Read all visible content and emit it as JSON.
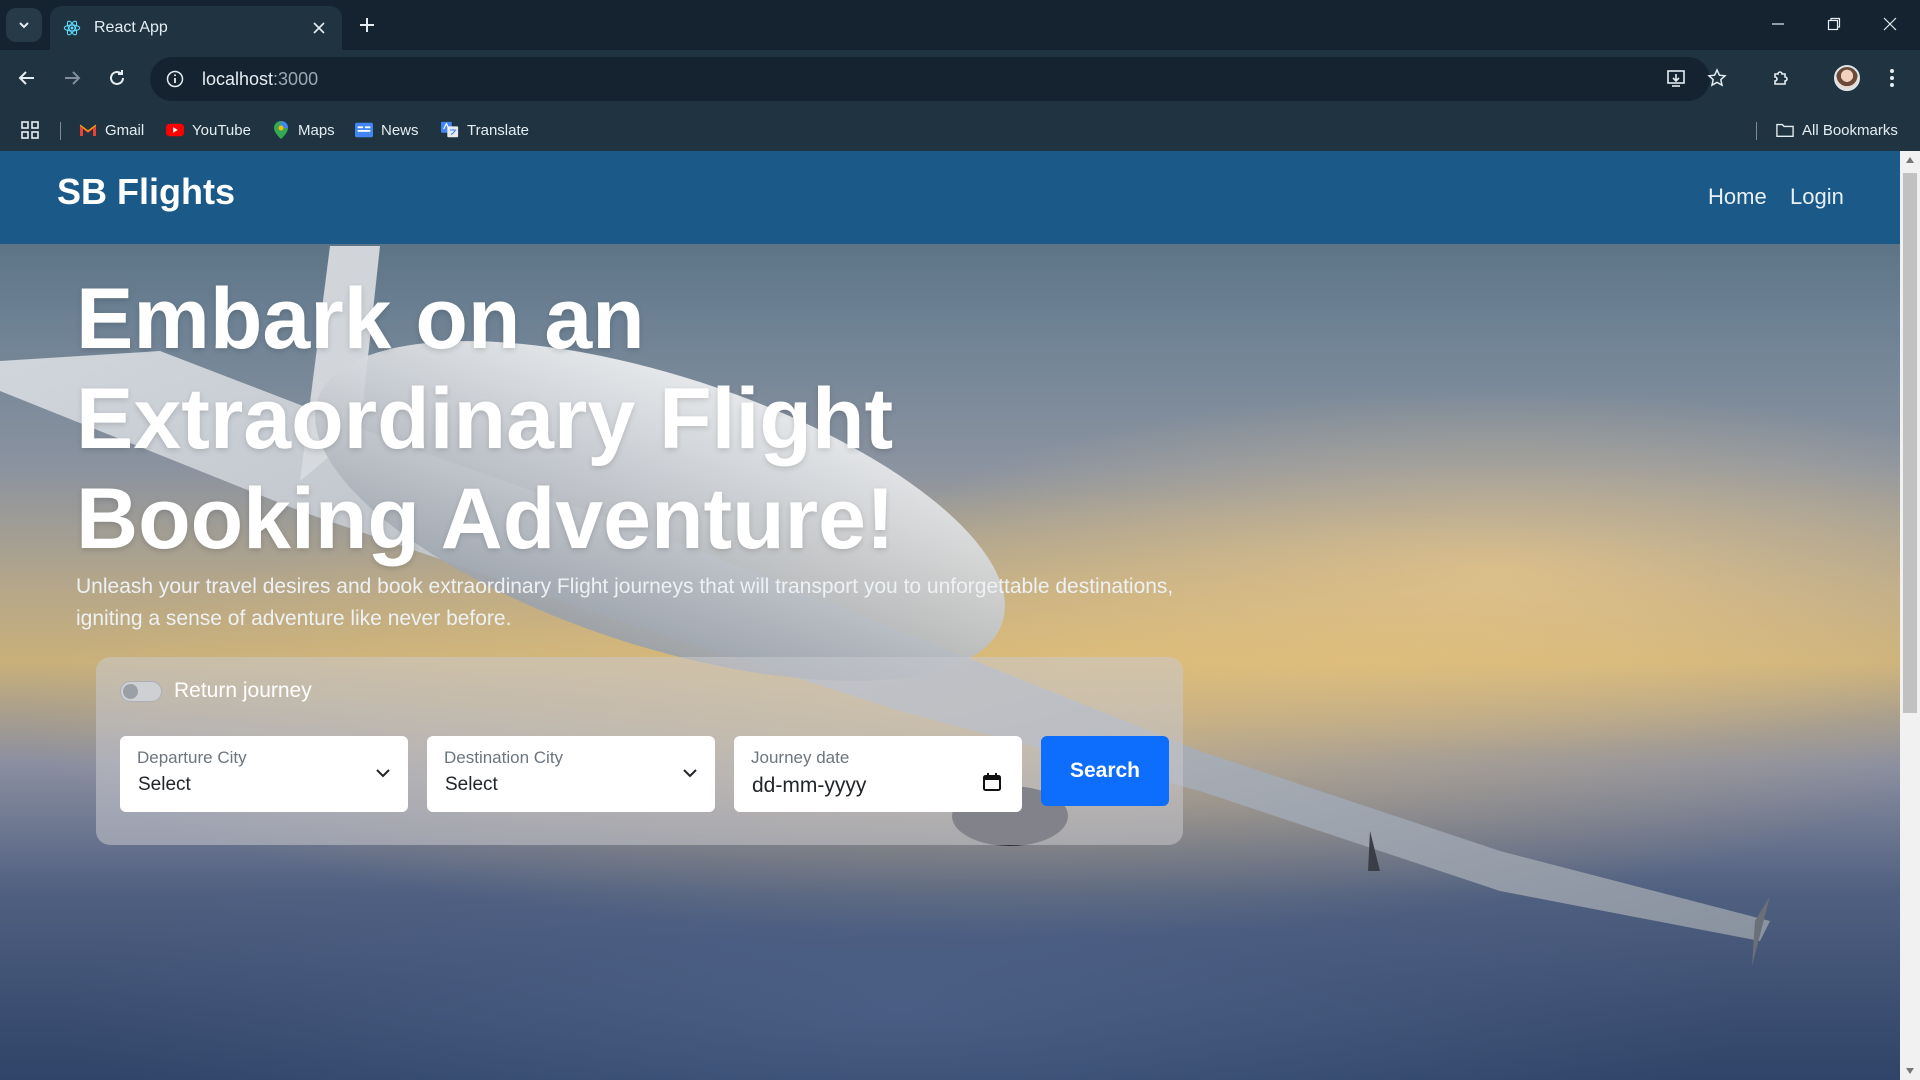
{
  "browser": {
    "tab_title": "React App",
    "url_host": "localhost",
    "url_port": ":3000",
    "bookmarks": [
      {
        "label": "Gmail",
        "icon": "gmail-icon"
      },
      {
        "label": "YouTube",
        "icon": "youtube-icon"
      },
      {
        "label": "Maps",
        "icon": "maps-icon"
      },
      {
        "label": "News",
        "icon": "news-icon"
      },
      {
        "label": "Translate",
        "icon": "translate-icon"
      }
    ],
    "all_bookmarks": "All Bookmarks"
  },
  "navbar": {
    "brand": "SB Flights",
    "links": [
      "Home",
      "Login"
    ]
  },
  "hero": {
    "headline": "Embark on an Extraordinary Flight Booking Adventure!",
    "subtitle": "Unleash your travel desires and book extraordinary Flight journeys that will transport you to unforgettable destinations, igniting a sense of adventure like never before."
  },
  "search_form": {
    "return_journey_label": "Return journey",
    "departure": {
      "label": "Departure City",
      "value": "Select"
    },
    "destination": {
      "label": "Destination City",
      "value": "Select"
    },
    "journey_date": {
      "label": "Journey date",
      "value": "dd-mm-yyyy"
    },
    "search_label": "Search"
  },
  "colors": {
    "navbar": "#1b5989",
    "search_button": "#0d6efd",
    "chrome": "#1f3440"
  }
}
